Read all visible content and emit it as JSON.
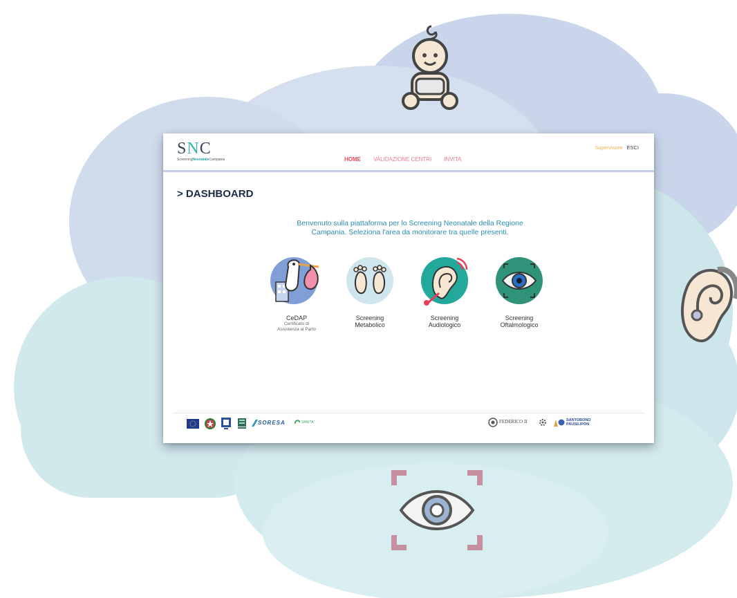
{
  "app": {
    "logo_mark_s": "S",
    "logo_mark_n": "N",
    "logo_mark_c": "C",
    "logo_sub_pre": "Screening",
    "logo_sub_bold": "Neonatale",
    "logo_sub_post": "Campania"
  },
  "nav": {
    "home": "HOME",
    "validazione": "VALIDAZIONE CENTRI",
    "invita": "INVITA"
  },
  "user": {
    "role": "Supervisore",
    "logout": "ESCI"
  },
  "main": {
    "title": "> DASHBOARD",
    "welcome_line1": "Benvenuto sulla piattaforma per lo Screening Neonatale della Regione",
    "welcome_line2": "Campania. Seleziona l'area da monitorare tra quelle presenti."
  },
  "tiles": [
    {
      "title": "CeDAP",
      "subtitle_line1": "Certificato di",
      "subtitle_line2": "Assistenza al Parto",
      "icon": "stork-icon"
    },
    {
      "title_line1": "Screening",
      "title_line2": "Metabolico",
      "icon": "baby-feet-icon"
    },
    {
      "title_line1": "Screening",
      "title_line2": "Audiologico",
      "icon": "ear-icon"
    },
    {
      "title_line1": "Screening",
      "title_line2": "Oftalmologico",
      "icon": "eye-icon"
    }
  ],
  "footer": {
    "logo_soresa": "SORESA",
    "logo_sanita": "SANITA'",
    "logo_federico": "FEDERICO II",
    "logo_santobono_1": "SANTOBONO",
    "logo_santobono_2": "PAUSILIPON"
  },
  "colors": {
    "cloud_blue": "#c9d5ea",
    "cloud_teal": "#d4ebee",
    "accent_teal": "#3bb3b0",
    "nav_pink": "#e04a5f",
    "role_orange": "#f0b050"
  }
}
